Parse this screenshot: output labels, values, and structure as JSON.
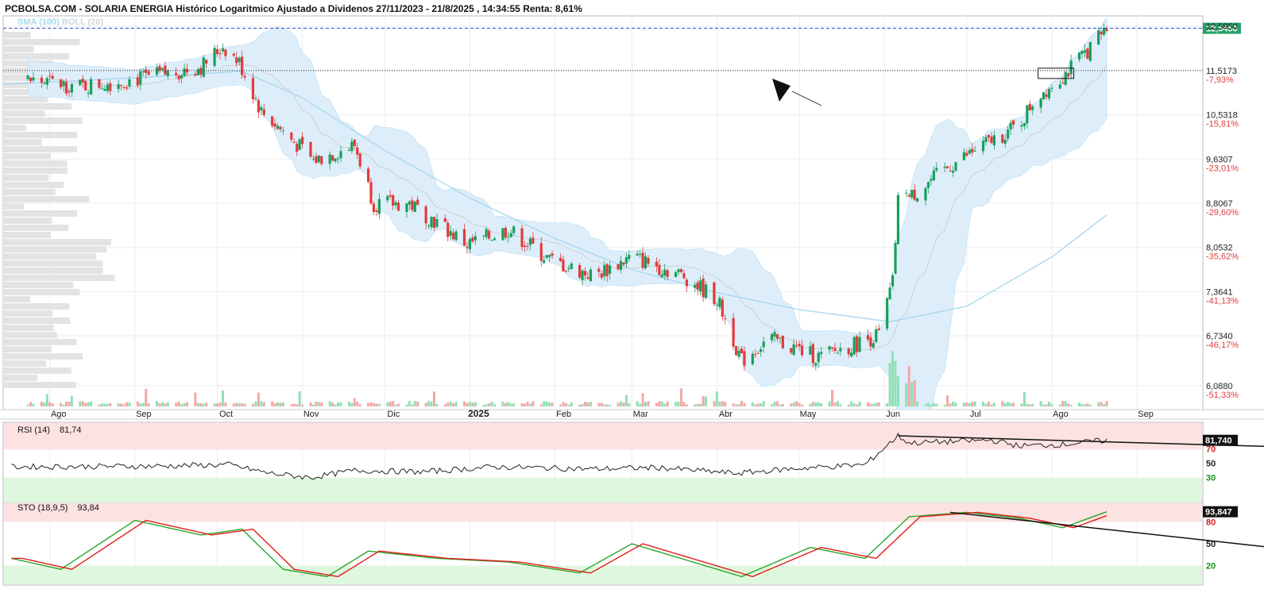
{
  "header": {
    "title": "PCBOLSA.COM - SOLARIA ENERGIA Histórico Logaritmico Ajustado a Dividenos 27/11/2023 - 21/8/2025 , 14:34:55 Renta: 8,61%",
    "indicator_sma": "SMA (100)",
    "indicator_boll": "BOLL (20)"
  },
  "colors": {
    "up": "#1a9e5c",
    "down": "#e23b3b",
    "boll_fill": "#dceefa",
    "sma_line": "#a9d8f0",
    "price_line": "#1f3fd0",
    "current_bg": "#26a269",
    "overbought_band": "#fde2e2",
    "oversold_band": "#dff7df",
    "sto_k": "#2aa52a",
    "sto_d": "#e21b1b"
  },
  "price_panel": {
    "levels": [
      {
        "price": "12,5950",
        "pct": ""
      },
      {
        "price": "11,5173",
        "pct": "-7,93%"
      },
      {
        "price": "10,5318",
        "pct": "-15,81%"
      },
      {
        "price": "9,6307",
        "pct": "-23,01%"
      },
      {
        "price": "8,8067",
        "pct": "-29,60%"
      },
      {
        "price": "8,0532",
        "pct": "-35,62%"
      },
      {
        "price": "7,3641",
        "pct": "-41,13%"
      },
      {
        "price": "6,7340",
        "pct": "-46,17%"
      },
      {
        "price": "6,0880",
        "pct": "-51,33%"
      }
    ],
    "current_price": "12,5450",
    "resistance": "11,5173",
    "months": [
      "Ago",
      "Sep",
      "Oct",
      "Nov",
      "Dic",
      "2025",
      "Feb",
      "Mar",
      "Abr",
      "May",
      "Jun",
      "Jul",
      "Ago",
      "Sep"
    ]
  },
  "rsi_panel": {
    "label": "RSI (14)",
    "value": "81,74",
    "current": "81,740",
    "ticks": [
      "70",
      "50",
      "30"
    ]
  },
  "sto_panel": {
    "label": "STO (18,9,5)",
    "value": "93,84",
    "current": "93,847",
    "ticks": [
      "80",
      "50",
      "20"
    ]
  },
  "chart_data": {
    "type": "candlestick",
    "title": "SOLARIA ENERGIA Histórico Logaritmico Ajustado a Dividenos 27/11/2023 - 21/8/2025",
    "y_scale": "log",
    "ylim": [
      6.0,
      12.7
    ],
    "x_range": [
      "2024-07-15",
      "2025-09-25"
    ],
    "grid": true,
    "last_price": 12.545,
    "resistance_level": 11.5173,
    "price_path": [
      [
        "2024-07-24",
        11.3
      ],
      [
        "2024-08-12",
        11.15
      ],
      [
        "2024-09-05",
        11.35
      ],
      [
        "2024-09-25",
        11.6
      ],
      [
        "2024-10-03",
        12.1
      ],
      [
        "2024-10-09",
        11.7
      ],
      [
        "2024-10-17",
        10.6
      ],
      [
        "2024-11-05",
        9.6
      ],
      [
        "2024-11-20",
        9.9
      ],
      [
        "2024-11-27",
        8.8
      ],
      [
        "2024-12-10",
        8.8
      ],
      [
        "2024-12-31",
        8.1
      ],
      [
        "2025-01-15",
        8.35
      ],
      [
        "2025-01-30",
        7.85
      ],
      [
        "2025-02-15",
        7.6
      ],
      [
        "2025-03-01",
        7.9
      ],
      [
        "2025-03-20",
        7.6
      ],
      [
        "2025-04-01",
        7.25
      ],
      [
        "2025-04-10",
        6.4
      ],
      [
        "2025-04-20",
        6.7
      ],
      [
        "2025-05-08",
        6.45
      ],
      [
        "2025-05-20",
        6.6
      ],
      [
        "2025-05-30",
        6.75
      ],
      [
        "2025-06-04",
        7.5
      ],
      [
        "2025-06-07",
        9.5
      ],
      [
        "2025-06-10",
        8.9
      ],
      [
        "2025-06-25",
        9.5
      ],
      [
        "2025-07-10",
        10.0
      ],
      [
        "2025-07-20",
        10.3
      ],
      [
        "2025-07-26",
        10.9
      ],
      [
        "2025-08-05",
        11.4
      ],
      [
        "2025-08-10",
        11.7
      ],
      [
        "2025-08-21",
        12.545
      ]
    ],
    "sma100_path": [
      [
        "2024-07-15",
        11.2
      ],
      [
        "2024-09-01",
        11.35
      ],
      [
        "2024-10-10",
        11.5
      ],
      [
        "2024-11-01",
        10.9
      ],
      [
        "2024-12-01",
        9.8
      ],
      [
        "2025-01-01",
        8.9
      ],
      [
        "2025-02-01",
        8.2
      ],
      [
        "2025-03-01",
        7.7
      ],
      [
        "2025-04-01",
        7.35
      ],
      [
        "2025-05-01",
        7.1
      ],
      [
        "2025-06-03",
        6.93
      ],
      [
        "2025-07-01",
        7.15
      ],
      [
        "2025-08-01",
        7.9
      ],
      [
        "2025-08-21",
        8.6
      ]
    ],
    "rsi": {
      "value": 81.74,
      "path": [
        [
          "2024-07-18",
          45
        ],
        [
          "2024-09-10",
          46
        ],
        [
          "2024-10-05",
          48
        ],
        [
          "2024-10-20",
          36
        ],
        [
          "2024-11-04",
          30
        ],
        [
          "2024-11-20",
          40
        ],
        [
          "2024-12-15",
          38
        ],
        [
          "2025-01-10",
          45
        ],
        [
          "2025-02-15",
          42
        ],
        [
          "2025-03-10",
          44
        ],
        [
          "2025-04-08",
          36
        ],
        [
          "2025-05-01",
          43
        ],
        [
          "2025-05-25",
          48
        ],
        [
          "2025-06-06",
          88
        ],
        [
          "2025-06-10",
          78
        ],
        [
          "2025-06-25",
          80
        ],
        [
          "2025-07-10",
          82
        ],
        [
          "2025-07-20",
          74
        ],
        [
          "2025-08-05",
          76
        ],
        [
          "2025-08-15",
          80
        ],
        [
          "2025-08-21",
          81.74
        ]
      ],
      "trendline": [
        [
          "2025-06-06",
          88
        ],
        [
          "2025-10-30",
          72
        ]
      ]
    },
    "stochastic": {
      "value": 93.84,
      "k_path": [
        [
          "2024-07-18",
          30
        ],
        [
          "2024-08-05",
          15
        ],
        [
          "2024-09-01",
          82
        ],
        [
          "2024-09-25",
          62
        ],
        [
          "2024-10-10",
          70
        ],
        [
          "2024-10-25",
          15
        ],
        [
          "2024-11-10",
          5
        ],
        [
          "2024-11-25",
          40
        ],
        [
          "2024-12-20",
          30
        ],
        [
          "2025-01-15",
          25
        ],
        [
          "2025-02-10",
          10
        ],
        [
          "2025-03-01",
          50
        ],
        [
          "2025-04-10",
          5
        ],
        [
          "2025-05-05",
          45
        ],
        [
          "2025-05-25",
          30
        ],
        [
          "2025-06-10",
          87
        ],
        [
          "2025-07-01",
          93
        ],
        [
          "2025-07-20",
          85
        ],
        [
          "2025-08-05",
          72
        ],
        [
          "2025-08-21",
          93.84
        ]
      ],
      "trendline": [
        [
          "2025-06-25",
          93
        ],
        [
          "2025-10-20",
          45
        ]
      ]
    }
  }
}
